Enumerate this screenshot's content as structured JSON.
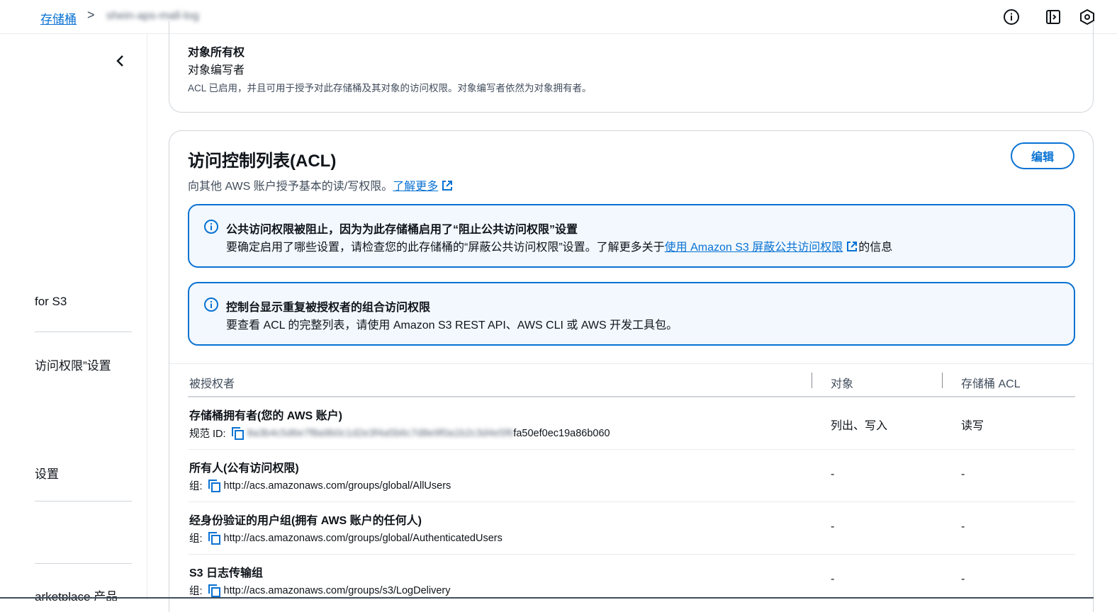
{
  "breadcrumb": {
    "root": "存储桶",
    "separator": ">",
    "current": "shein-aps-mall-log"
  },
  "icons": {
    "info": "info-icon",
    "panel": "side-panel-icon",
    "settings": "hexagon-settings-icon",
    "collapse": "chevron-left-icon",
    "external": "external-link-icon",
    "copy": "copy-icon"
  },
  "colors": {
    "link": "#0972d3",
    "alert_bg": "#f2f8fd",
    "border": "#d1d5db"
  },
  "sidebar": {
    "items": [
      {
        "label": "for S3"
      },
      {
        "label": "访问权限”设置"
      },
      {
        "label": "设置"
      },
      {
        "label": "arketplace 产品"
      }
    ]
  },
  "ownership": {
    "title": "对象所有权",
    "value": "对象编写者",
    "description": "ACL 已启用，并且可用于授予对此存储桶及其对象的访问权限。对象编写者依然为对象拥有者。"
  },
  "acl": {
    "title": "访问控制列表(ACL)",
    "description": "向其他 AWS 账户授予基本的读/写权限。",
    "learn_more": "了解更多",
    "edit_label": "编辑",
    "alerts": [
      {
        "title": "公共访问权限被阻止，因为为此存储桶启用了“阻止公共访问权限”设置",
        "body_prefix": "要确定启用了哪些设置，请检查您的此存储桶的“屏蔽公共访问权限”设置。了解更多关于",
        "link": "使用 Amazon S3 屏蔽公共访问权限",
        "body_suffix": "的信息"
      },
      {
        "title": "控制台显示重复被授权者的组合访问权限",
        "body_prefix": "要查看 ACL 的完整列表，请使用 Amazon S3 REST API、AWS CLI 或 AWS 开发工具包。"
      }
    ],
    "table": {
      "headers": [
        "被授权者",
        "对象",
        "存储桶 ACL"
      ],
      "rows": [
        {
          "grantee": "存储桶拥有者(您的 AWS 账户)",
          "sub_label": "规范 ID:",
          "sub_value_hidden": "8a3b4c5d6e7f8a9b0c1d2e3f4a5b6c7d8e9f0a1b2c3d4e5f6",
          "sub_value": "fa50ef0ec19a86b060",
          "objects": "列出、写入",
          "bucket_acl": "读写"
        },
        {
          "grantee": "所有人(公有访问权限)",
          "sub_label": "组:",
          "sub_value": "http://acs.amazonaws.com/groups/global/AllUsers",
          "objects": "-",
          "bucket_acl": "-"
        },
        {
          "grantee": "经身份验证的用户组(拥有 AWS 账户的任何人)",
          "sub_label": "组:",
          "sub_value": "http://acs.amazonaws.com/groups/global/AuthenticatedUsers",
          "objects": "-",
          "bucket_acl": "-"
        },
        {
          "grantee": "S3 日志传输组",
          "sub_label": "组:",
          "sub_value": "http://acs.amazonaws.com/groups/s3/LogDelivery",
          "objects": "-",
          "bucket_acl": "-"
        }
      ]
    }
  }
}
